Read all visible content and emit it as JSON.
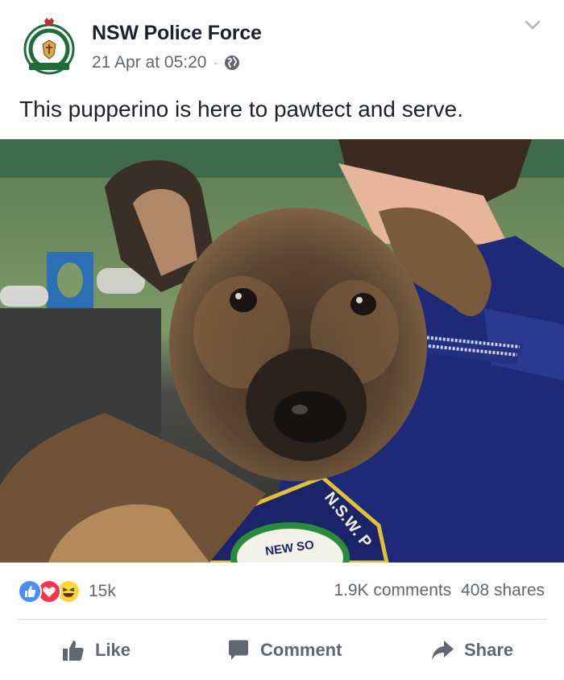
{
  "post": {
    "page_name": "NSW Police Force",
    "timestamp": "21 Apr at 05:20",
    "separator": "·",
    "audience_icon": "globe-icon",
    "menu_icon": "chevron-down-icon",
    "text": "This pupperino is here to pawtect and serve.",
    "photo_description_icon": "photo"
  },
  "engagement": {
    "reaction_icons": [
      "like-icon",
      "love-icon",
      "haha-icon"
    ],
    "reaction_count": "15k",
    "comments": "1.9K comments",
    "shares": "408 shares"
  },
  "actions": {
    "like_label": "Like",
    "comment_label": "Comment",
    "share_label": "Share"
  },
  "patch": {
    "text_top": "N.S.W. P",
    "text_bottom": "NEW SO"
  },
  "colors": {
    "text_primary": "#1d2129",
    "text_secondary": "#616770",
    "like_blue": "#4b8ff6",
    "love_red": "#f0374f",
    "haha_yellow": "#fcd53f",
    "uniform_navy": "#1e2a78"
  }
}
